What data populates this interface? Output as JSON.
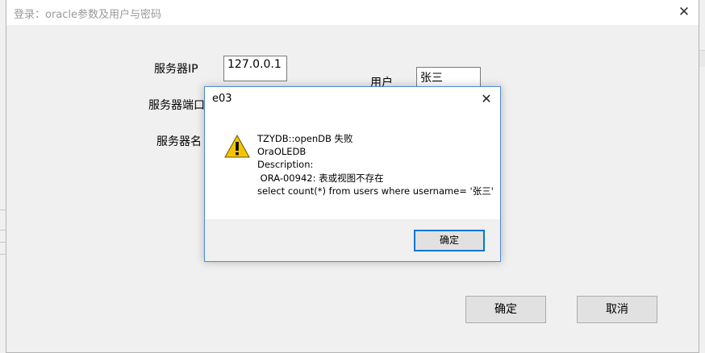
{
  "window": {
    "title": "登录：oracle参数及用户与密码",
    "close_glyph": "✕"
  },
  "form": {
    "server_ip_label": "服务器IP",
    "server_ip_value": "127.0.0.1",
    "server_port_label": "服务器端口",
    "server_name_label": "服务器名",
    "user_label": "用户",
    "user_value": "张三"
  },
  "buttons": {
    "ok": "确定",
    "cancel": "取消"
  },
  "message_box": {
    "title": "e03",
    "close_glyph": "✕",
    "icon": "warning-icon",
    "lines": [
      "TZYDB::openDB 失败",
      "OraOLEDB",
      "Description:",
      " ORA-00942: 表或视图不存在",
      "select count(*) from users where username= '张三'"
    ],
    "ok_button": "确定"
  },
  "colors": {
    "msg_border": "#4a8ad8",
    "warn_fill": "#f5c400",
    "button_bg": "#e1e1e1",
    "focus_border": "#0078d7"
  }
}
